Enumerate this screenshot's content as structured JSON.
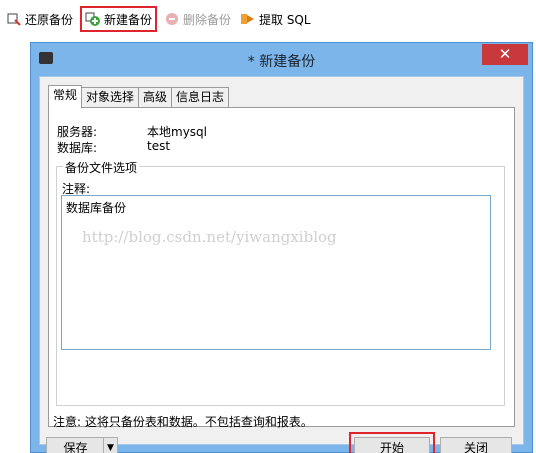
{
  "toolbar": {
    "restore_label": "还原备份",
    "new_label": "新建备份",
    "delete_label": "删除备份",
    "extract_label": "提取 SQL"
  },
  "dialog": {
    "title": "* 新建备份",
    "close_glyph": "✕",
    "tabs": [
      {
        "label": "常规"
      },
      {
        "label": "对象选择"
      },
      {
        "label": "高级"
      },
      {
        "label": "信息日志"
      }
    ],
    "server_label": "服务器:",
    "server_value": "本地mysql",
    "database_label": "数据库:",
    "database_value": "test",
    "group_title": "备份文件选项",
    "comment_label": "注释:",
    "comment_value": "数据库备份",
    "note": "注意: 这将只备份表和数据。不包括查询和报表。",
    "save_label": "保存",
    "start_label": "开始",
    "close_label": "关闭"
  },
  "watermark": "http://blog.csdn.net/yiwangxiblog",
  "colors": {
    "highlight": "#e0242e",
    "title_bar": "#7cb5e9",
    "close_button": "#c9383a"
  }
}
